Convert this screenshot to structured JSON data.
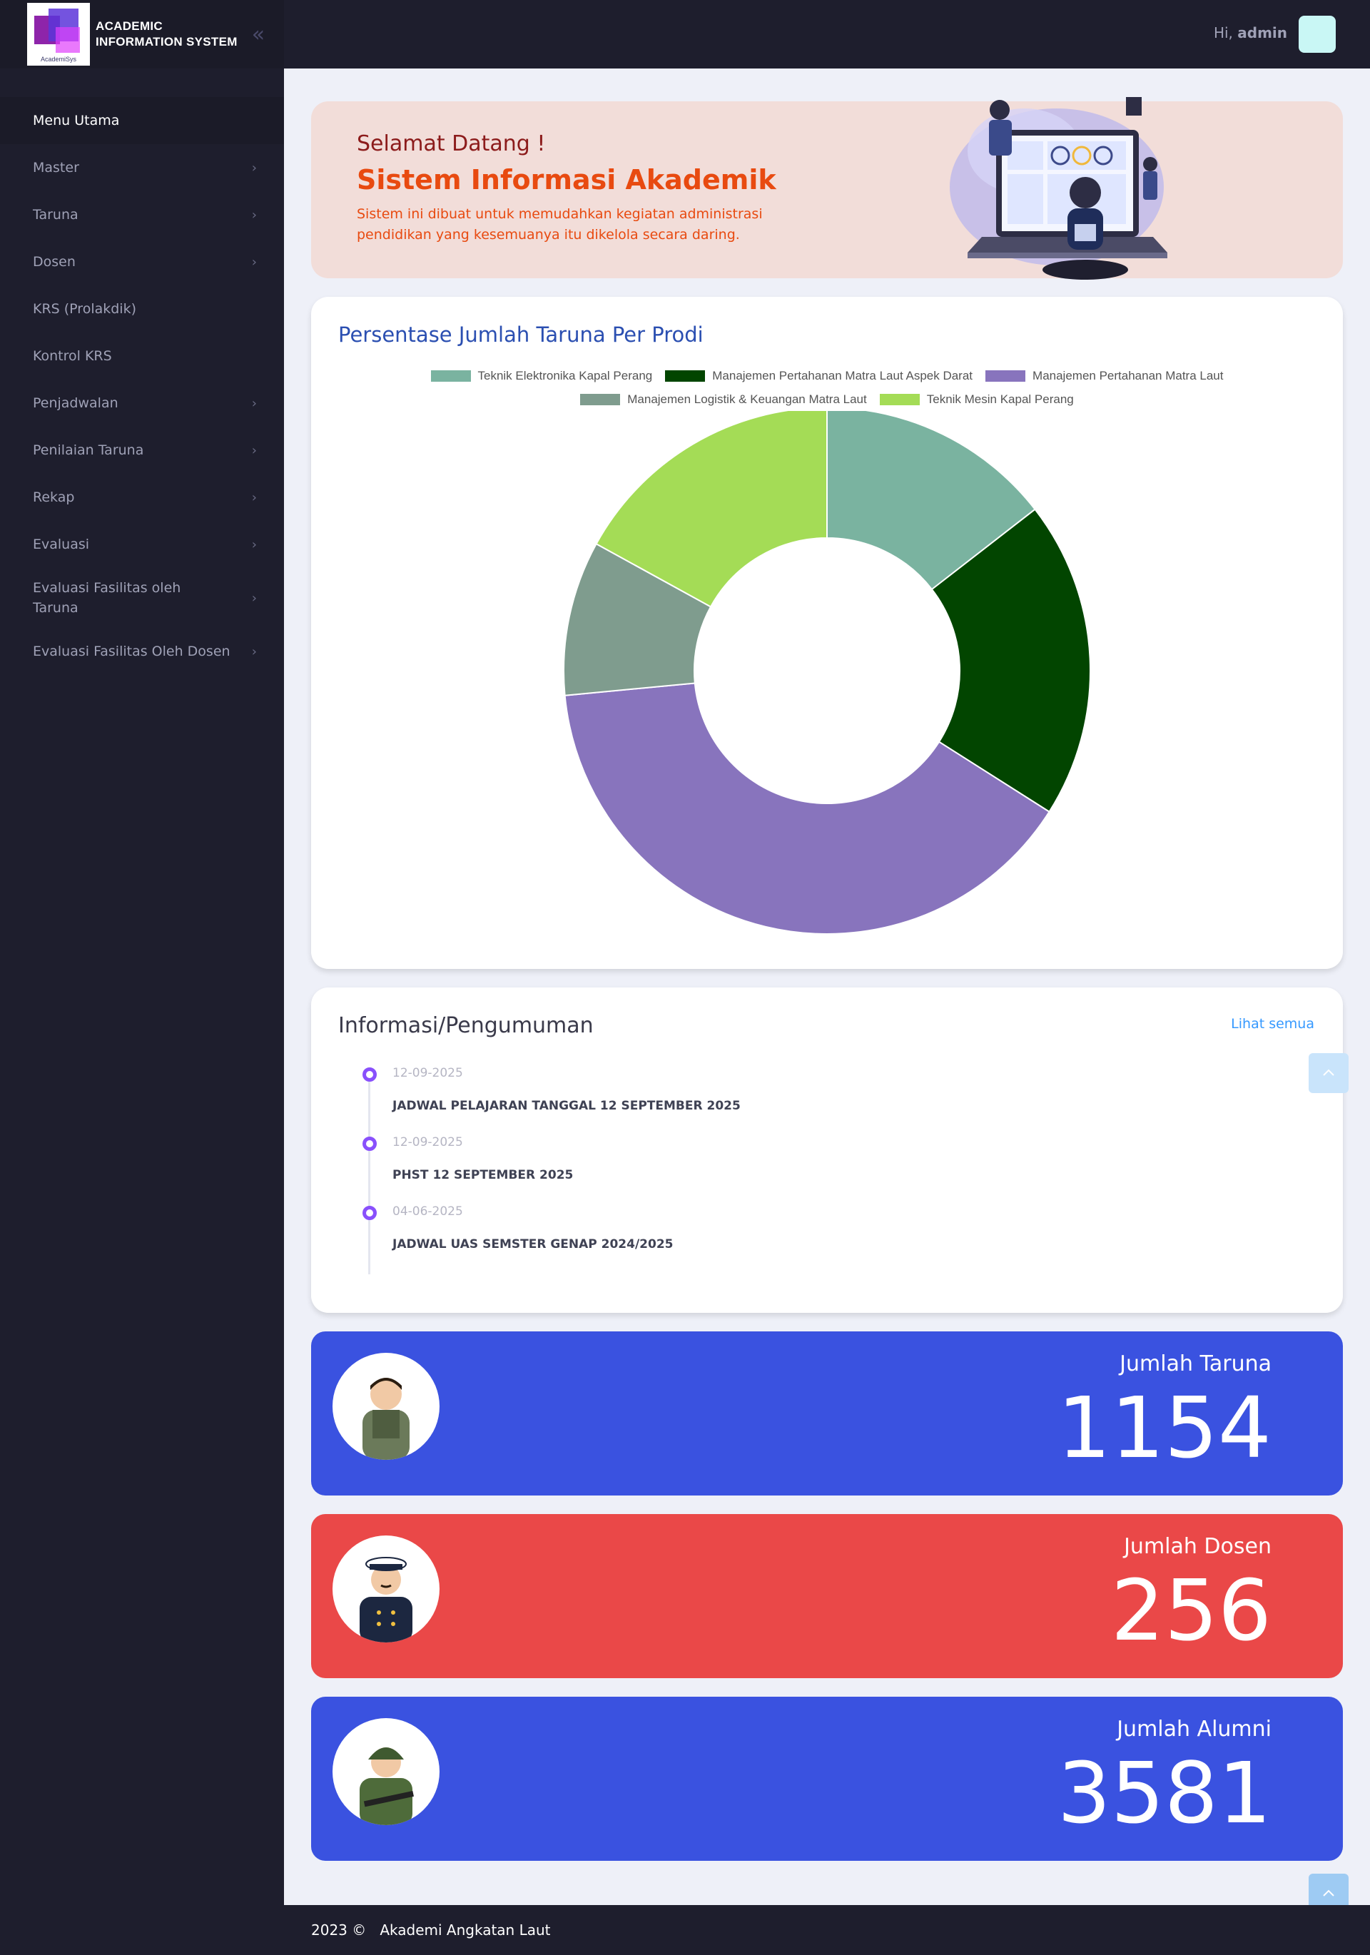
{
  "brand": {
    "line1": "ACADEMIC",
    "line2": "INFORMATION SYSTEM",
    "logo_caption": "AcademiSys"
  },
  "sidebar": {
    "items": [
      {
        "label": "Menu Utama",
        "active": true,
        "has_submenu": false
      },
      {
        "label": "Master",
        "active": false,
        "has_submenu": true
      },
      {
        "label": "Taruna",
        "active": false,
        "has_submenu": true
      },
      {
        "label": "Dosen",
        "active": false,
        "has_submenu": true
      },
      {
        "label": "KRS (Prolakdik)",
        "active": false,
        "has_submenu": false
      },
      {
        "label": "Kontrol KRS",
        "active": false,
        "has_submenu": false
      },
      {
        "label": "Penjadwalan",
        "active": false,
        "has_submenu": true
      },
      {
        "label": "Penilaian Taruna",
        "active": false,
        "has_submenu": true
      },
      {
        "label": "Rekap",
        "active": false,
        "has_submenu": true
      },
      {
        "label": "Evaluasi",
        "active": false,
        "has_submenu": true
      },
      {
        "label": "Evaluasi Fasilitas oleh Taruna",
        "active": false,
        "has_submenu": true
      },
      {
        "label": "Evaluasi Fasilitas Oleh Dosen",
        "active": false,
        "has_submenu": true
      }
    ]
  },
  "topbar": {
    "greeting_prefix": "Hi,",
    "username": "admin"
  },
  "welcome": {
    "greeting": "Selamat Datang !",
    "title": "Sistem Informasi Akademik",
    "description": "Sistem ini dibuat untuk memudahkan kegiatan administrasi pendidikan yang kesemuanya itu dikelola secara daring."
  },
  "chart_section": {
    "title": "Persentase Jumlah Taruna Per Prodi"
  },
  "chart_data": {
    "type": "pie",
    "title": "Persentase Jumlah Taruna Per Prodi",
    "legend_position": "top",
    "donut": true,
    "categories": [
      "Teknik Elektronika Kapal Perang",
      "Manajemen Pertahanan Matra Laut Aspek Darat",
      "Manajemen Pertahanan Matra Laut",
      "Manajemen Logistik & Keuangan Matra Laut",
      "Teknik Mesin Kapal Perang"
    ],
    "values": [
      14.5,
      19.5,
      39.5,
      9.5,
      17.0
    ],
    "colors": [
      "#7ab3a0",
      "#024500",
      "#8874bd",
      "#7f9c8e",
      "#a4dc56"
    ]
  },
  "announcements": {
    "title": "Informasi/Pengumuman",
    "see_all": "Lihat semua",
    "items": [
      {
        "date": "12-09-2025",
        "text": "JADWAL PELAJARAN TANGGAL 12 SEPTEMBER 2025"
      },
      {
        "date": "12-09-2025",
        "text": "PHST 12 SEPTEMBER 2025"
      },
      {
        "date": "04-06-2025",
        "text": "JADWAL UAS SEMSTER GENAP 2024/2025"
      }
    ]
  },
  "stats": {
    "taruna": {
      "label": "Jumlah Taruna",
      "value": "1154",
      "color": "#3a52e0"
    },
    "dosen": {
      "label": "Jumlah Dosen",
      "value": "256",
      "color": "#ea4848"
    },
    "alumni": {
      "label": "Jumlah Alumni",
      "value": "3581",
      "color": "#3a52e0"
    }
  },
  "footer": {
    "year": "2023 ©",
    "org": "Akademi Angkatan Laut"
  }
}
